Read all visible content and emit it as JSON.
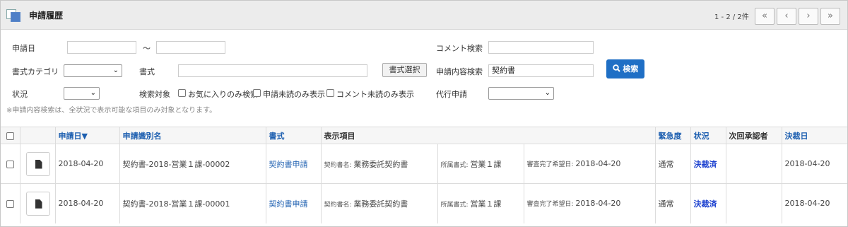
{
  "header": {
    "title": "申請履歴",
    "pager_info": "1 - 2 / 2件",
    "first_icon": "«",
    "prev_icon": "‹",
    "next_icon": "›",
    "last_icon": "»"
  },
  "filters": {
    "apply_date_label": "申請日",
    "date_from_value": "",
    "date_sep": "～",
    "date_to_value": "",
    "comment_search_label": "コメント検索",
    "comment_search_value": "",
    "form_category_label": "書式カテゴリ",
    "form_category_value": "",
    "form_label": "書式",
    "form_value": "",
    "form_select_button": "書式選択",
    "content_search_label": "申請内容検索",
    "content_search_value": "契約書",
    "search_button": "検索",
    "status_label": "状況",
    "status_value": "",
    "search_target_label": "検索対象",
    "opt_favorites": "お気に入りのみ検索",
    "opt_unread_apply": "申請未読のみ表示",
    "opt_unread_comment": "コメント未読のみ表示",
    "proxy_label": "代行申請",
    "proxy_value": "",
    "note": "※申請内容検索は、全状況で表示可能な項目のみ対象となります。"
  },
  "table": {
    "headers": {
      "apply_date": "申請日▼",
      "apply_id": "申請識別名",
      "form": "書式",
      "display_items": "表示項目",
      "urgency": "緊急度",
      "status": "状況",
      "next_approver": "次回承認者",
      "decision_date": "決裁日"
    },
    "rows": [
      {
        "apply_date": "2018-04-20",
        "apply_id": "契約書-2018-営業１課-00002",
        "form": "契約書申請",
        "item1_label": "契約書名:",
        "item1_value": "業務委託契約書",
        "item2_label": "所属書式:",
        "item2_value": "営業１課",
        "item3_label": "審査完了希望日:",
        "item3_value": "2018-04-20",
        "urgency": "通常",
        "status": "決裁済",
        "next_approver": "",
        "decision_date": "2018-04-20"
      },
      {
        "apply_date": "2018-04-20",
        "apply_id": "契約書-2018-営業１課-00001",
        "form": "契約書申請",
        "item1_label": "契約書名:",
        "item1_value": "業務委託契約書",
        "item2_label": "所属書式:",
        "item2_value": "営業１課",
        "item3_label": "審査完了希望日:",
        "item3_value": "2018-04-20",
        "urgency": "通常",
        "status": "決裁済",
        "next_approver": "",
        "decision_date": "2018-04-20"
      }
    ]
  },
  "colors": {
    "accent": "#1f6fc5",
    "link": "#1d5fb0",
    "status": "#1a3fcf"
  }
}
